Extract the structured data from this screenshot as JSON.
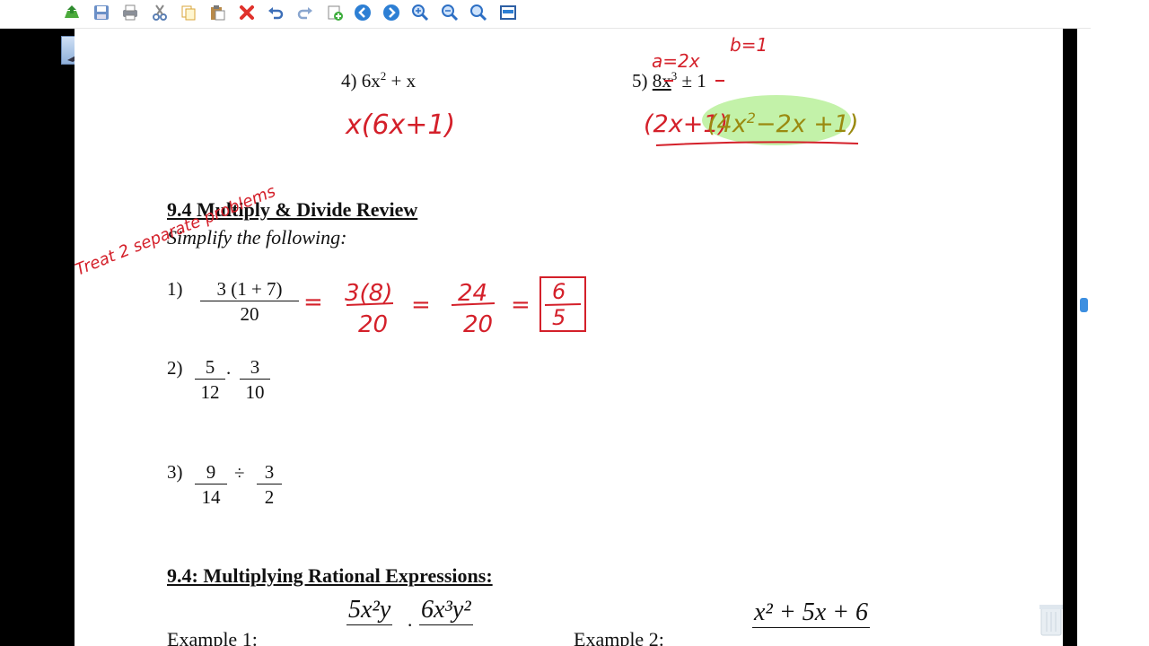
{
  "toolbar": {
    "buttons": [
      "open-icon",
      "save-icon",
      "print-icon",
      "cut-icon",
      "copy-icon",
      "paste-icon",
      "delete-icon",
      "undo-icon",
      "redo-icon",
      "add-page-icon",
      "back-icon",
      "forward-icon",
      "zoom-in-icon",
      "zoom-out-icon",
      "zoom-fit-icon",
      "screen-icon"
    ]
  },
  "problems_top": {
    "p4": {
      "num": "4)",
      "expr": "6x",
      "sup": "2",
      "rest": " + x",
      "work": "x(6x+1)"
    },
    "p5": {
      "num": "5)",
      "expr": "8x",
      "sup": "3",
      "rest": " ± 1",
      "note_a": "a=2x",
      "note_b": "b=1",
      "work1": "(2x+1)",
      "work2": "(4x",
      "work2sup": "2",
      "work2rest": "−2x +1)"
    }
  },
  "section1": {
    "title": "9.4 Multiply & Divide Review",
    "subtitle": "Simplify the following:",
    "side_note": "Treat 2 separate problems",
    "q1": {
      "num": "1)",
      "numer": "3 (1 + 7)",
      "denom": "20",
      "work": [
        "3(8)",
        "20",
        "24",
        "20",
        "6",
        "5"
      ]
    },
    "q2": {
      "num": "2)",
      "a_num": "5",
      "a_den": "12",
      "op": ".",
      "b_num": "3",
      "b_den": "10"
    },
    "q3": {
      "num": "3)",
      "a_num": "9",
      "a_den": "14",
      "op": "÷",
      "b_num": "3",
      "b_den": "2"
    }
  },
  "section2": {
    "title": "9.4:  Multiplying Rational Expressions:",
    "ex1_label": "Example 1:",
    "ex1_num_a": "5x²y",
    "ex1_num_b": "6x³y²",
    "ex2_label": "Example 2:",
    "ex2_num": "x² + 5x + 6"
  },
  "colors": {
    "ink_red": "#d4202a",
    "highlight": "#b9f09a",
    "accent": "#3d8fe0"
  }
}
